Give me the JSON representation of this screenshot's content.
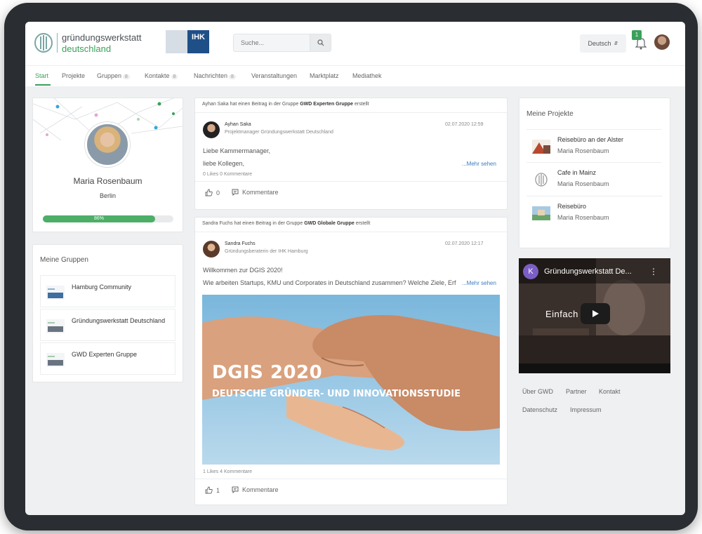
{
  "brand": {
    "line1": "gründungswerkstatt",
    "line2": "deutschland",
    "partner": "IHK",
    "accent": "#3aa15a"
  },
  "header": {
    "search_placeholder": "Suche...",
    "language": "Deutsch",
    "notification_count": "1"
  },
  "nav": {
    "items": [
      {
        "label": "Start"
      },
      {
        "label": "Projekte"
      },
      {
        "label": "Gruppen"
      },
      {
        "label": "Kontakte"
      },
      {
        "label": "Nachrichten"
      },
      {
        "label": "Veranstaltungen"
      },
      {
        "label": "Marktplatz"
      },
      {
        "label": "Mediathek"
      }
    ],
    "counts": [
      "8",
      "8",
      "8"
    ]
  },
  "profile": {
    "name": "Maria Rosenbaum",
    "city": "Berlin",
    "progress_label": "86%",
    "progress_value": 0.86
  },
  "groups": {
    "title": "Meine Gruppen",
    "items": [
      {
        "name": "Hamburg Community"
      },
      {
        "name": "Gründungswerkstatt Deutschland"
      },
      {
        "name": "GWD Experten Gruppe"
      }
    ]
  },
  "feed": [
    {
      "head_user": "Ayhan Saka",
      "head_mid": "hat einen Beitrag in der Gruppe",
      "head_group": "GWD Experten Gruppe",
      "head_end": "erstellt",
      "author": "Ayhan Saka",
      "role": "Projektmanager Gründungswerkstatt Deutschland",
      "date": "02.07.2020 12:59",
      "line1": "Liebe Kammermanager,",
      "line2": "liebe Kollegen,",
      "more": "...Mehr sehen",
      "stats": "0 Likes   0 Kommentare",
      "likes": "0",
      "comments_label": "Kommentare"
    },
    {
      "head_user": "Sandra Fuchs",
      "head_mid": "hat einen Beitrag in der Gruppe",
      "head_group": "GWD Globale Gruppe",
      "head_end": "erstellt",
      "author": "Sandra Fuchs",
      "role": "Gründungsberaterin der IHK Hamburg",
      "date": "02.07.2020 12:17",
      "line1": "Willkommen zur DGIS 2020!",
      "line2": "Wie arbeiten Startups, KMU und Corporates in Deutschland zusammen? Welche Ziele, Erf",
      "more": "...Mehr sehen",
      "image_title": "DGIS 2020",
      "image_subtitle": "DEUTSCHE GRÜNDER- UND INNOVATIONSSTUDIE",
      "stats": "1 Likes   4 Kommentare",
      "likes": "1",
      "comments_label": "Kommentare"
    }
  ],
  "projects": {
    "title": "Meine Projekte",
    "items": [
      {
        "title": "Reisebüro an der Alster",
        "owner": "Maria Rosenbaum"
      },
      {
        "title": "Cafe in Mainz",
        "owner": "Maria Rosenbaum"
      },
      {
        "title": "Reisebüro",
        "owner": "Maria Rosenbaum"
      }
    ]
  },
  "video": {
    "channel_letter": "K",
    "title": "Gründungswerkstatt De...",
    "caption": "Einfach   nzplan"
  },
  "footer": {
    "links": [
      "Über GWD",
      "Partner",
      "Kontakt",
      "Datenschutz",
      "Impressum"
    ]
  }
}
